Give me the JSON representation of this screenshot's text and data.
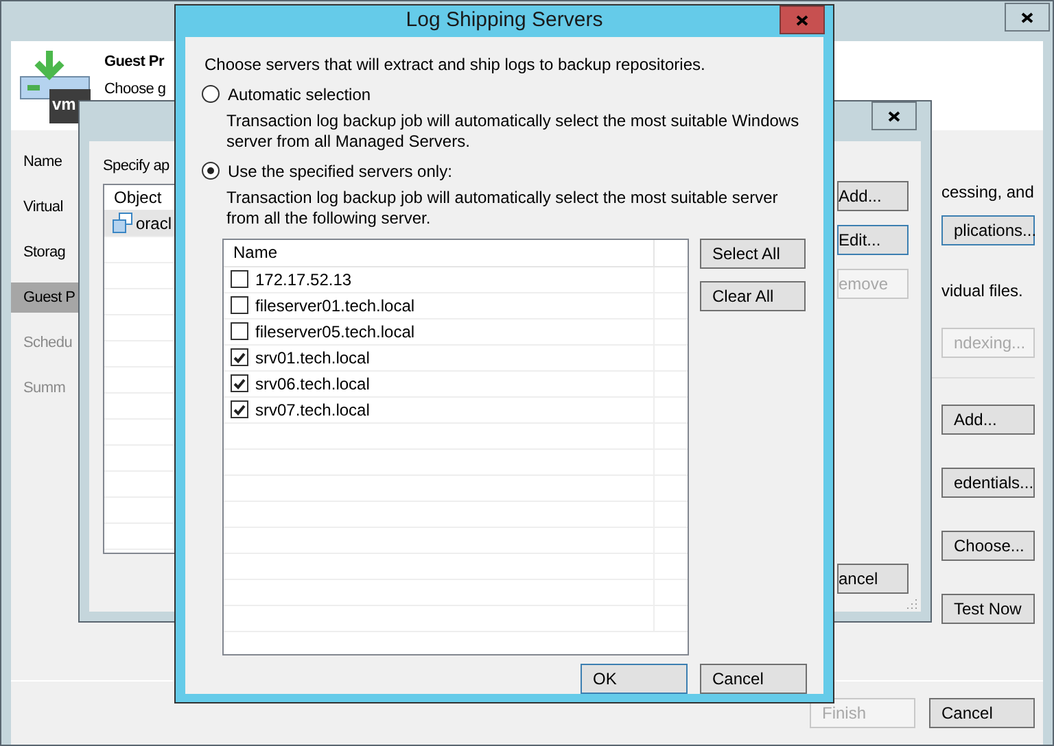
{
  "main_window": {
    "header": {
      "logo_text": "vm",
      "title": "Guest Pr",
      "subtitle": "Choose g"
    },
    "steps": [
      {
        "label": "Name",
        "selected": false,
        "disabled": false
      },
      {
        "label": "Virtual",
        "selected": false,
        "disabled": false
      },
      {
        "label": "Storag",
        "selected": false,
        "disabled": false
      },
      {
        "label": "Guest P",
        "selected": true,
        "disabled": false
      },
      {
        "label": "Schedu",
        "selected": false,
        "disabled": true
      },
      {
        "label": "Summ",
        "selected": false,
        "disabled": true
      }
    ],
    "side_items": [
      {
        "kind": "text",
        "label": "cessing, and"
      },
      {
        "kind": "button",
        "label": "plications...",
        "disabled": false,
        "focused": true
      },
      {
        "kind": "text",
        "label": "vidual files."
      },
      {
        "kind": "button",
        "label": "ndexing...",
        "disabled": true,
        "focused": false
      },
      {
        "kind": "divider"
      },
      {
        "kind": "button",
        "label": "Add...",
        "disabled": false,
        "focused": false
      },
      {
        "kind": "button",
        "label": "edentials...",
        "disabled": false,
        "focused": false
      },
      {
        "kind": "button",
        "label": "Choose...",
        "disabled": false,
        "focused": false
      },
      {
        "kind": "button",
        "label": "Test Now",
        "disabled": false,
        "focused": false
      }
    ],
    "buttons": [
      {
        "label": "Finish",
        "disabled": true
      },
      {
        "label": "Cancel",
        "disabled": false
      }
    ]
  },
  "app_dialog": {
    "prompt": "Specify ap",
    "table": {
      "columns": [
        "Object"
      ],
      "rows": [
        {
          "name": "oracl",
          "selected": true
        }
      ]
    },
    "buttons": [
      {
        "label": "Add...",
        "disabled": false,
        "focused": false
      },
      {
        "label": "Edit...",
        "disabled": false,
        "focused": true
      },
      {
        "label": "emove",
        "disabled": true,
        "focused": false
      }
    ],
    "cancel": "ancel"
  },
  "log_dialog": {
    "title": "Log Shipping Servers",
    "intro": "Choose servers that will extract and ship logs to backup repositories.",
    "options": [
      {
        "label": "Automatic selection",
        "selected": false,
        "description": [
          "Transaction log backup job will automatically select the most suitable Windows",
          "server from all Managed Servers."
        ]
      },
      {
        "label": "Use the specified servers only:",
        "selected": true,
        "description": [
          "Transaction log backup job will automatically select the most suitable server",
          "from all the following server."
        ]
      }
    ],
    "table": {
      "columns": [
        "Name"
      ],
      "rows": [
        {
          "name": "172.17.52.13",
          "checked": false
        },
        {
          "name": "fileserver01.tech.local",
          "checked": false
        },
        {
          "name": "fileserver05.tech.local",
          "checked": false
        },
        {
          "name": "srv01.tech.local",
          "checked": true
        },
        {
          "name": "srv06.tech.local",
          "checked": true
        },
        {
          "name": "srv07.tech.local",
          "checked": true
        }
      ]
    },
    "side_buttons": [
      "Select All",
      "Clear All"
    ],
    "buttons": [
      {
        "label": "OK",
        "focused": true
      },
      {
        "label": "Cancel",
        "focused": false
      }
    ]
  }
}
